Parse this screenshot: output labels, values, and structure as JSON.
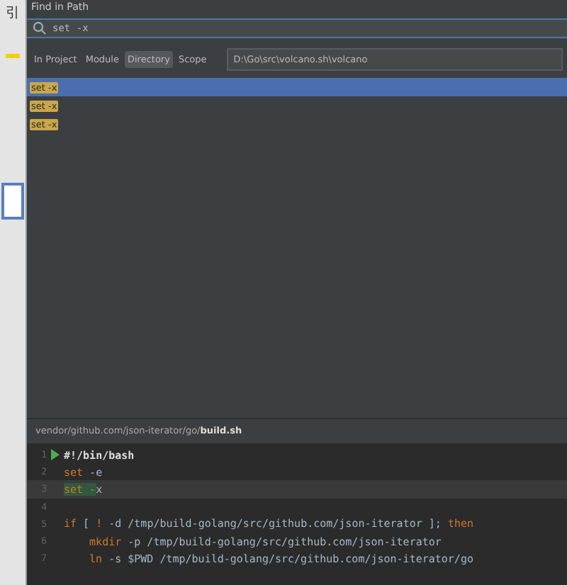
{
  "background_app": {
    "label": "引"
  },
  "window": {
    "title": "Find in Path"
  },
  "search": {
    "value": "set -x"
  },
  "scopes": [
    {
      "label": "In Project",
      "selected": false
    },
    {
      "label": "Module",
      "selected": false
    },
    {
      "label": "Directory",
      "selected": true
    },
    {
      "label": "Scope",
      "selected": false
    }
  ],
  "directory": {
    "value": "D:\\Go\\src\\volcano.sh\\volcano"
  },
  "results": [
    {
      "text": "set -x",
      "selected": true
    },
    {
      "text": "set -x",
      "selected": false
    },
    {
      "text": "set -x",
      "selected": false
    }
  ],
  "preview": {
    "path": "vendor/github.com/json-iterator/go/",
    "file": "build.sh",
    "lines": [
      {
        "number": "1",
        "run": true,
        "current": false,
        "tokens": [
          {
            "kind": "bold",
            "text": "#!/bin/bash"
          }
        ]
      },
      {
        "number": "2",
        "run": false,
        "current": false,
        "tokens": [
          {
            "kind": "keyword",
            "text": "set"
          },
          {
            "kind": "plain",
            "text": " -e"
          }
        ]
      },
      {
        "number": "3",
        "run": false,
        "current": true,
        "tokens": [
          {
            "kind": "match",
            "text": "set -"
          },
          {
            "kind": "plain",
            "text": "x"
          }
        ]
      },
      {
        "number": "4",
        "run": false,
        "current": false
      },
      {
        "number": "5",
        "run": false,
        "current": false,
        "tokens": [
          {
            "kind": "keyword",
            "text": "if"
          },
          {
            "kind": "plain",
            "text": " [ "
          },
          {
            "kind": "keyword",
            "text": "!"
          },
          {
            "kind": "plain",
            "text": " -d /tmp/build-golang/src/github.com/json-iterator ]; "
          },
          {
            "kind": "keyword",
            "text": "then"
          }
        ]
      },
      {
        "number": "6",
        "run": false,
        "current": false,
        "indented": true,
        "tokens": [
          {
            "kind": "keyword",
            "text": "mkdir"
          },
          {
            "kind": "plain",
            "text": " -p /tmp/build-golang/src/github.com/json-iterator"
          }
        ]
      },
      {
        "number": "7",
        "run": false,
        "current": false,
        "indented": true,
        "tokens": [
          {
            "kind": "keyword",
            "text": "ln"
          },
          {
            "kind": "plain",
            "text": " -s $PWD /tmp/build-golang/src/github.com/json-iterator/go"
          }
        ]
      }
    ]
  }
}
